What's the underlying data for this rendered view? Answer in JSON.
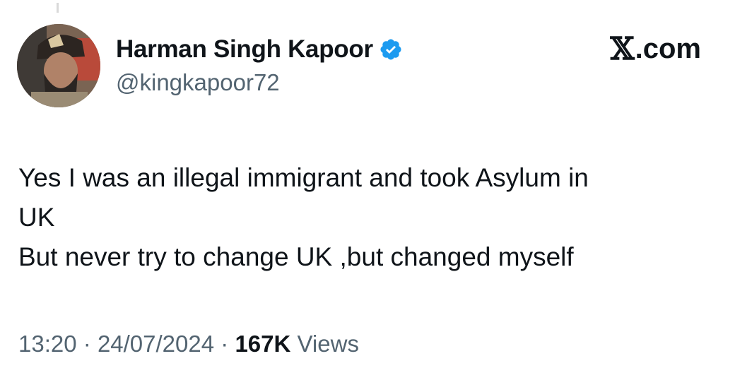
{
  "author": {
    "display_name": "Harman Singh Kapoor",
    "handle": "@kingkapoor72",
    "verified": true,
    "avatar_icon": "profile-photo"
  },
  "brand": {
    "label": "X.com",
    "x_mark": "𝕏",
    "suffix": ".com"
  },
  "tweet": {
    "lines": [
      "Yes I was an illegal immigrant and took Asylum in",
      "UK",
      "But never try to change UK ,but changed myself"
    ]
  },
  "meta": {
    "time": "13:20",
    "separator": "·",
    "date": "24/07/2024",
    "views_count": "167K",
    "views_label": "Views"
  },
  "colors": {
    "text_primary": "#0f1419",
    "text_secondary": "#536471",
    "verified_blue": "#1d9bf0"
  }
}
